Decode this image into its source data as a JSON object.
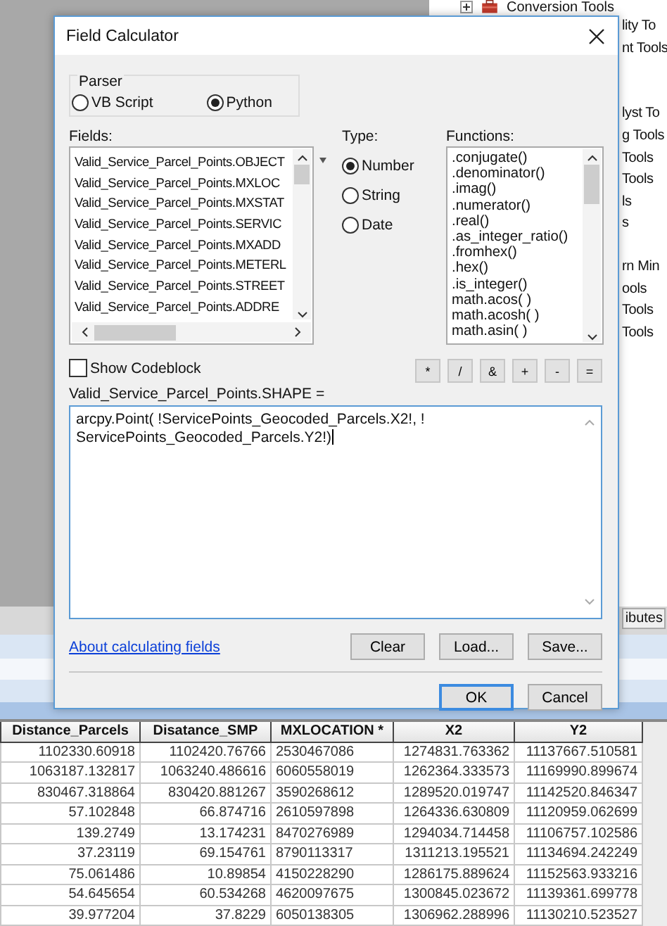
{
  "toolbox_tree": {
    "items": [
      {
        "label": "Conversion Tools",
        "kind": "toolbox"
      },
      {
        "label": "lity To",
        "kind": "fragment"
      },
      {
        "label": "nt Tools",
        "kind": "fragment"
      },
      {
        "label": "lyst To",
        "kind": "fragment"
      },
      {
        "label": "g Tools",
        "kind": "fragment"
      },
      {
        "label": "Tools",
        "kind": "fragment"
      },
      {
        "label": "Tools",
        "kind": "fragment"
      },
      {
        "label": "ls",
        "kind": "fragment"
      },
      {
        "label": "s",
        "kind": "fragment"
      },
      {
        "label": "rn Min",
        "kind": "fragment"
      },
      {
        "label": "ools",
        "kind": "fragment"
      },
      {
        "label": "Tools",
        "kind": "fragment"
      },
      {
        "label": "Tools",
        "kind": "fragment"
      }
    ]
  },
  "tab_fragment": "ibutes",
  "dialog": {
    "title": "Field Calculator",
    "parser": {
      "label": "Parser",
      "options": [
        {
          "label": "VB Script",
          "selected": false
        },
        {
          "label": "Python",
          "selected": true
        }
      ]
    },
    "fields": {
      "label": "Fields:",
      "items": [
        "Valid_Service_Parcel_Points.OBJECT",
        "Valid_Service_Parcel_Points.MXLOC",
        "Valid_Service_Parcel_Points.MXSTAT",
        "Valid_Service_Parcel_Points.SERVIC",
        "Valid_Service_Parcel_Points.MXADD",
        "Valid_Service_Parcel_Points.METERL",
        "Valid_Service_Parcel_Points.STREET",
        "Valid_Service_Parcel_Points.ADDRE"
      ]
    },
    "type": {
      "label": "Type:",
      "options": [
        {
          "label": "Number",
          "selected": true
        },
        {
          "label": "String",
          "selected": false
        },
        {
          "label": "Date",
          "selected": false
        }
      ]
    },
    "functions": {
      "label": "Functions:",
      "items": [
        ".conjugate()",
        ".denominator()",
        ".imag()",
        ".numerator()",
        ".real()",
        ".as_integer_ratio()",
        ".fromhex()",
        ".hex()",
        ".is_integer()",
        "math.acos( )",
        "math.acosh( )",
        "math.asin( )"
      ]
    },
    "show_codeblock": {
      "label": "Show Codeblock",
      "checked": false
    },
    "operators": [
      "*",
      "/",
      "&",
      "+",
      "-",
      "="
    ],
    "expression_label": "Valid_Service_Parcel_Points.SHAPE =",
    "expression_lines": [
      "arcpy.Point( !ServicePoints_Geocoded_Parcels.X2!, !",
      "ServicePoints_Geocoded_Parcels.Y2!)"
    ],
    "help_link": "About calculating fields",
    "buttons": [
      "Clear",
      "Load...",
      "Save..."
    ],
    "dialog_buttons": [
      {
        "label": "OK",
        "default": true
      },
      {
        "label": "Cancel",
        "default": false
      }
    ]
  },
  "table": {
    "columns": [
      {
        "label": "Distance_Parcels",
        "kind": "number"
      },
      {
        "label": "Disatance_SMP",
        "kind": "number"
      },
      {
        "label": "MXLOCATION *",
        "kind": "text"
      },
      {
        "label": "X2",
        "kind": "number"
      },
      {
        "label": "Y2",
        "kind": "number"
      }
    ],
    "rows": [
      [
        "1102330.60918",
        "1102420.76766",
        "2530467086",
        "1274831.763362",
        "11137667.510581"
      ],
      [
        "1063187.132817",
        "1063240.486616",
        "6060558019",
        "1262364.333573",
        "11169990.899674"
      ],
      [
        "830467.318864",
        "830420.881267",
        "3590268612",
        "1289520.019747",
        "11142520.846347"
      ],
      [
        "57.102848",
        "66.874716",
        "2610597898",
        "1264336.630809",
        "11120959.062699"
      ],
      [
        "139.2749",
        "13.174231",
        "8470276989",
        "1294034.714458",
        "11106757.102586"
      ],
      [
        "37.23119",
        "69.154761",
        "8790113317",
        "1311213.195521",
        "11134694.242249"
      ],
      [
        "75.061486",
        "10.89854",
        "4150228290",
        "1286175.889624",
        "11152563.933216"
      ],
      [
        "54.645654",
        "60.534268",
        "4620097675",
        "1300845.023672",
        "11139361.699778"
      ],
      [
        "39.977204",
        "37.8229",
        "6050138305",
        "1306962.288996",
        "11130210.523527"
      ]
    ]
  }
}
